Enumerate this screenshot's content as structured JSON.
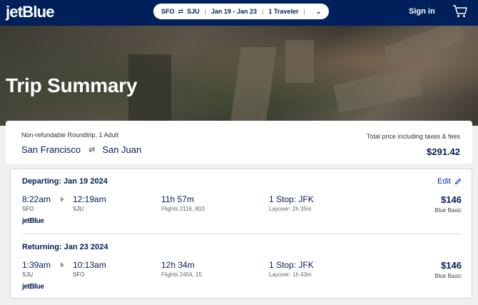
{
  "header": {
    "logo": "jetBlue",
    "search": {
      "origin": "SFO",
      "swap_icon": "⇄",
      "destination": "SJU",
      "dates": "Jan 19 - Jan 23",
      "travelers": "1 Traveler",
      "chevron": "⌄"
    },
    "signin_label": "Sign in",
    "cart_icon": "cart-icon"
  },
  "hero": {
    "title": "Trip Summary"
  },
  "summary": {
    "fare_type": "Non-refundable Roundtrip, 1 Adult",
    "origin_city": "San Francisco",
    "swap_icon": "⇄",
    "destination_city": "San Juan",
    "total_label": "Total price including taxes & fees",
    "total_price": "$291.42"
  },
  "legs": [
    {
      "heading": "Departing: Jan 19 2024",
      "edit_label": "Edit",
      "depart_time": "8:22am",
      "depart_code": "SFO",
      "arrive_time": "12:19am",
      "arrive_code": "SJU",
      "duration": "11h 57m",
      "flights": "Flights 2116, 803",
      "stops": "1 Stop: JFK",
      "layover": "Layover: 2h 35m",
      "price": "$146",
      "fare_class": "Blue Basic",
      "carrier": "jetBlue"
    },
    {
      "heading": "Returning: Jan 23 2024",
      "depart_time": "1:39am",
      "depart_code": "SJU",
      "arrive_time": "10:13am",
      "arrive_code": "SFO",
      "duration": "12h 34m",
      "flights": "Flights 2404, 15",
      "stops": "1 Stop: JFK",
      "layover": "Layover: 1h 43m",
      "price": "$146",
      "fare_class": "Blue Basic",
      "carrier": "jetBlue"
    }
  ],
  "colors": {
    "brand_navy": "#00205b",
    "link_blue": "#0033a0"
  }
}
